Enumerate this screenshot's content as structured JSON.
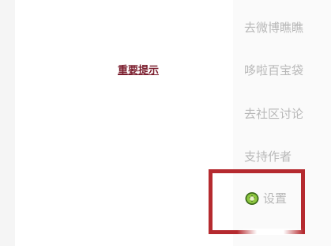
{
  "main": {
    "notice_link": "重要提示"
  },
  "menu": {
    "items": [
      {
        "label": "去微博瞧瞧"
      },
      {
        "label": "哆啦百宝袋"
      },
      {
        "label": "去社区讨论"
      },
      {
        "label": "支持作者"
      }
    ],
    "settings": {
      "label": "设置",
      "icon": "kiwi-icon"
    }
  },
  "colors": {
    "link": "#7a1c2c",
    "menu_text": "#b8b8b8",
    "highlight": "#b52a2f",
    "kiwi_green": "#6fa52a"
  }
}
